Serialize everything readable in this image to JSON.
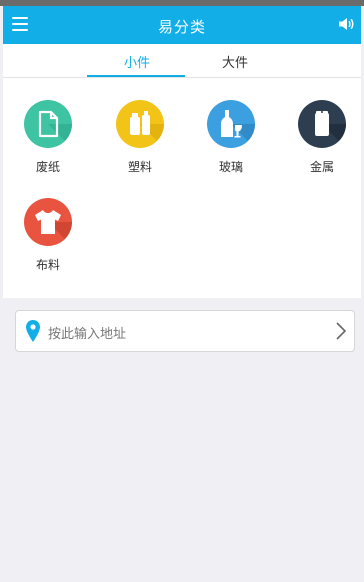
{
  "header": {
    "title": "易分类",
    "menu_icon": "menu-icon",
    "sound_icon": "speaker-icon"
  },
  "tabs": [
    {
      "label": "小件",
      "active": true
    },
    {
      "label": "大件",
      "active": false
    }
  ],
  "categories": [
    {
      "label": "废纸",
      "icon": "paper-icon",
      "color": "#3ec3a3"
    },
    {
      "label": "塑料",
      "icon": "plastic-bottle-icon",
      "color": "#f2c418"
    },
    {
      "label": "玻璃",
      "icon": "glass-bottle-icon",
      "color": "#3c9fe0"
    },
    {
      "label": "金属",
      "icon": "can-icon",
      "color": "#2c3e50"
    },
    {
      "label": "布料",
      "icon": "tshirt-icon",
      "color": "#e8543f"
    }
  ],
  "address": {
    "placeholder": "按此输入地址",
    "pin_icon": "location-pin-icon",
    "arrow_icon": "chevron-right-icon"
  },
  "colors": {
    "accent": "#12aee8",
    "background": "#efeff4"
  }
}
